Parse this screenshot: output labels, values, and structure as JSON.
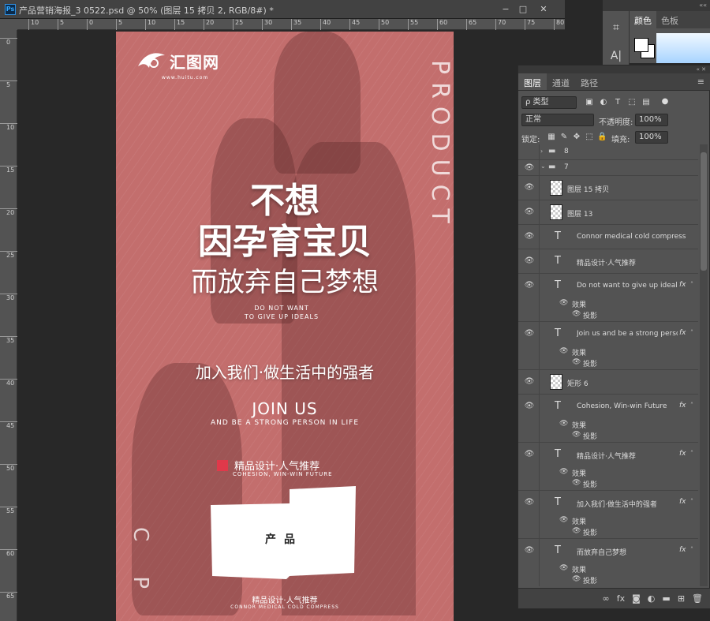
{
  "doc": {
    "title": "产品营销海报_3 0522.psd @ 50% (图层 15 拷贝 2, RGB/8#) *",
    "minimize": "−",
    "restore": "□",
    "close": "✕",
    "ps_logo": "Ps"
  },
  "rulers": {
    "top": [
      "10",
      "5",
      "0",
      "5",
      "10",
      "15",
      "20",
      "25",
      "30",
      "35",
      "40",
      "45",
      "50",
      "55",
      "60",
      "65",
      "70",
      "75",
      "80"
    ],
    "left": [
      "0",
      "5",
      "10",
      "15",
      "20",
      "25",
      "30",
      "35",
      "40",
      "45",
      "50",
      "55",
      "60",
      "65"
    ]
  },
  "poster": {
    "logo_text": "汇图网",
    "logo_url": "www.huitu.com",
    "vertical_product": "PRODUCT",
    "vertical_cp": "C P",
    "headline1": "不想",
    "headline2": "因孕育宝贝",
    "headline3": "而放弃自己梦想",
    "small_en_1": "DO NOT WANT",
    "small_en_2": "TO GIVE UP IDEALS",
    "join_cn": "加入我们·做生活中的强者",
    "join_us": "JOIN US",
    "join_sub": "AND BE A STRONG PERSON IN LIFE",
    "design_cn": "精品设计·人气推荐",
    "design_en": "COHESION, WIN-WIN FUTURE",
    "product_label": "产品",
    "bottom_cn": "精品设计·人气推荐",
    "bottom_en": "CONNOR MEDICAL COLD COMPRESS",
    "bg_color": "#c36e6d",
    "accent": "#e0394a"
  },
  "color_panel": {
    "tabs": [
      "颜色",
      "色板"
    ]
  },
  "tools": {
    "icons": [
      "history-icon",
      "type-icon"
    ],
    "glyphs": [
      "⌗",
      "A|"
    ]
  },
  "layers_panel": {
    "tabs": [
      "图层",
      "通道",
      "路径"
    ],
    "filter_label": "ρ 类型",
    "blend_mode": "正常",
    "opacity_label": "不透明度:",
    "opacity_value": "100%",
    "lock_label": "锁定:",
    "fill_label": "填充:",
    "fill_value": "100%",
    "effects_label": "效果",
    "shadow_label": "投影",
    "layers": [
      {
        "name": "8",
        "kind": "group-closed"
      },
      {
        "name": "7",
        "kind": "group-open"
      },
      {
        "name": "图层 15 拷贝",
        "kind": "pixel"
      },
      {
        "name": "图层 13",
        "kind": "pixel"
      },
      {
        "name": "Connor medical cold compress",
        "kind": "text"
      },
      {
        "name": "精品设计·人气推荐",
        "kind": "text"
      },
      {
        "name": "Do not want  to give up ideals",
        "kind": "text-fx"
      },
      {
        "name": "Join us  and be a strong perso...",
        "kind": "text-fx"
      },
      {
        "name": "矩形 6",
        "kind": "shape"
      },
      {
        "name": "Cohesion, Win-win Future",
        "kind": "text-fx"
      },
      {
        "name": "精品设计·人气推荐",
        "kind": "text-fx"
      },
      {
        "name": "加入我们·做生活中的强者",
        "kind": "text-fx"
      },
      {
        "name": "而放弃自己梦想",
        "kind": "text-fx"
      }
    ]
  }
}
